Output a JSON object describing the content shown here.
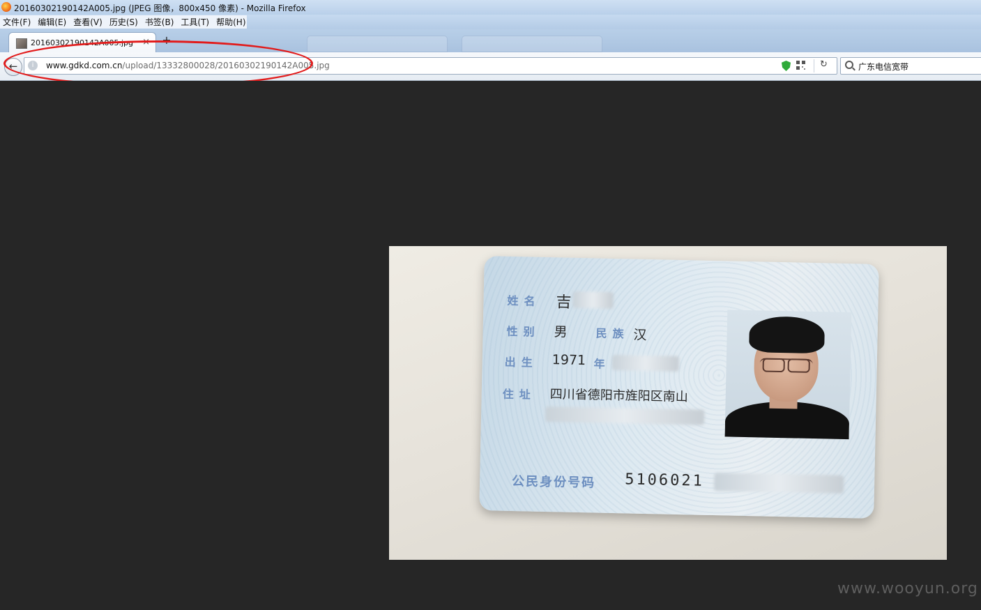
{
  "window": {
    "title": "20160302190142A005.jpg (JPEG 图像，800x450 像素) - Mozilla Firefox"
  },
  "menubar": {
    "items": [
      "文件(F)",
      "编辑(E)",
      "查看(V)",
      "历史(S)",
      "书签(B)",
      "工具(T)",
      "帮助(H)"
    ]
  },
  "tabs": {
    "active_label": "20160302190142A005.jpg (",
    "close_glyph": "×",
    "new_tab_glyph": "+"
  },
  "navbar": {
    "back_glyph": "←",
    "url_host": "www.gdkd.com.cn",
    "url_path": "/upload/13332800028/20160302190142A005.jpg",
    "reload_glyph": "↻",
    "search_text": "广东电信宽带"
  },
  "idcard": {
    "name_label": "姓名",
    "name_value": "吉",
    "gender_label": "性别",
    "gender_value": "男",
    "ethnicity_label": "民族",
    "ethnicity_value": "汉",
    "birth_label": "出生",
    "birth_year": "1971",
    "year_char": "年",
    "address_label": "住址",
    "address_value": "四川省德阳市旌阳区南山",
    "id_label": "公民身份号码",
    "id_number": "5106021"
  },
  "watermark": "www.wooyun.org",
  "icons": {
    "firefox": "firefox-icon",
    "favicon": "image-favicon-icon",
    "site": "site-identity-icon",
    "shield": "shield-icon",
    "qr": "qr-code-icon",
    "reload": "reload-icon",
    "search": "search-icon"
  },
  "colors": {
    "highlight": "#e21b1b",
    "background": "#262626",
    "shield": "#2faa3a"
  }
}
